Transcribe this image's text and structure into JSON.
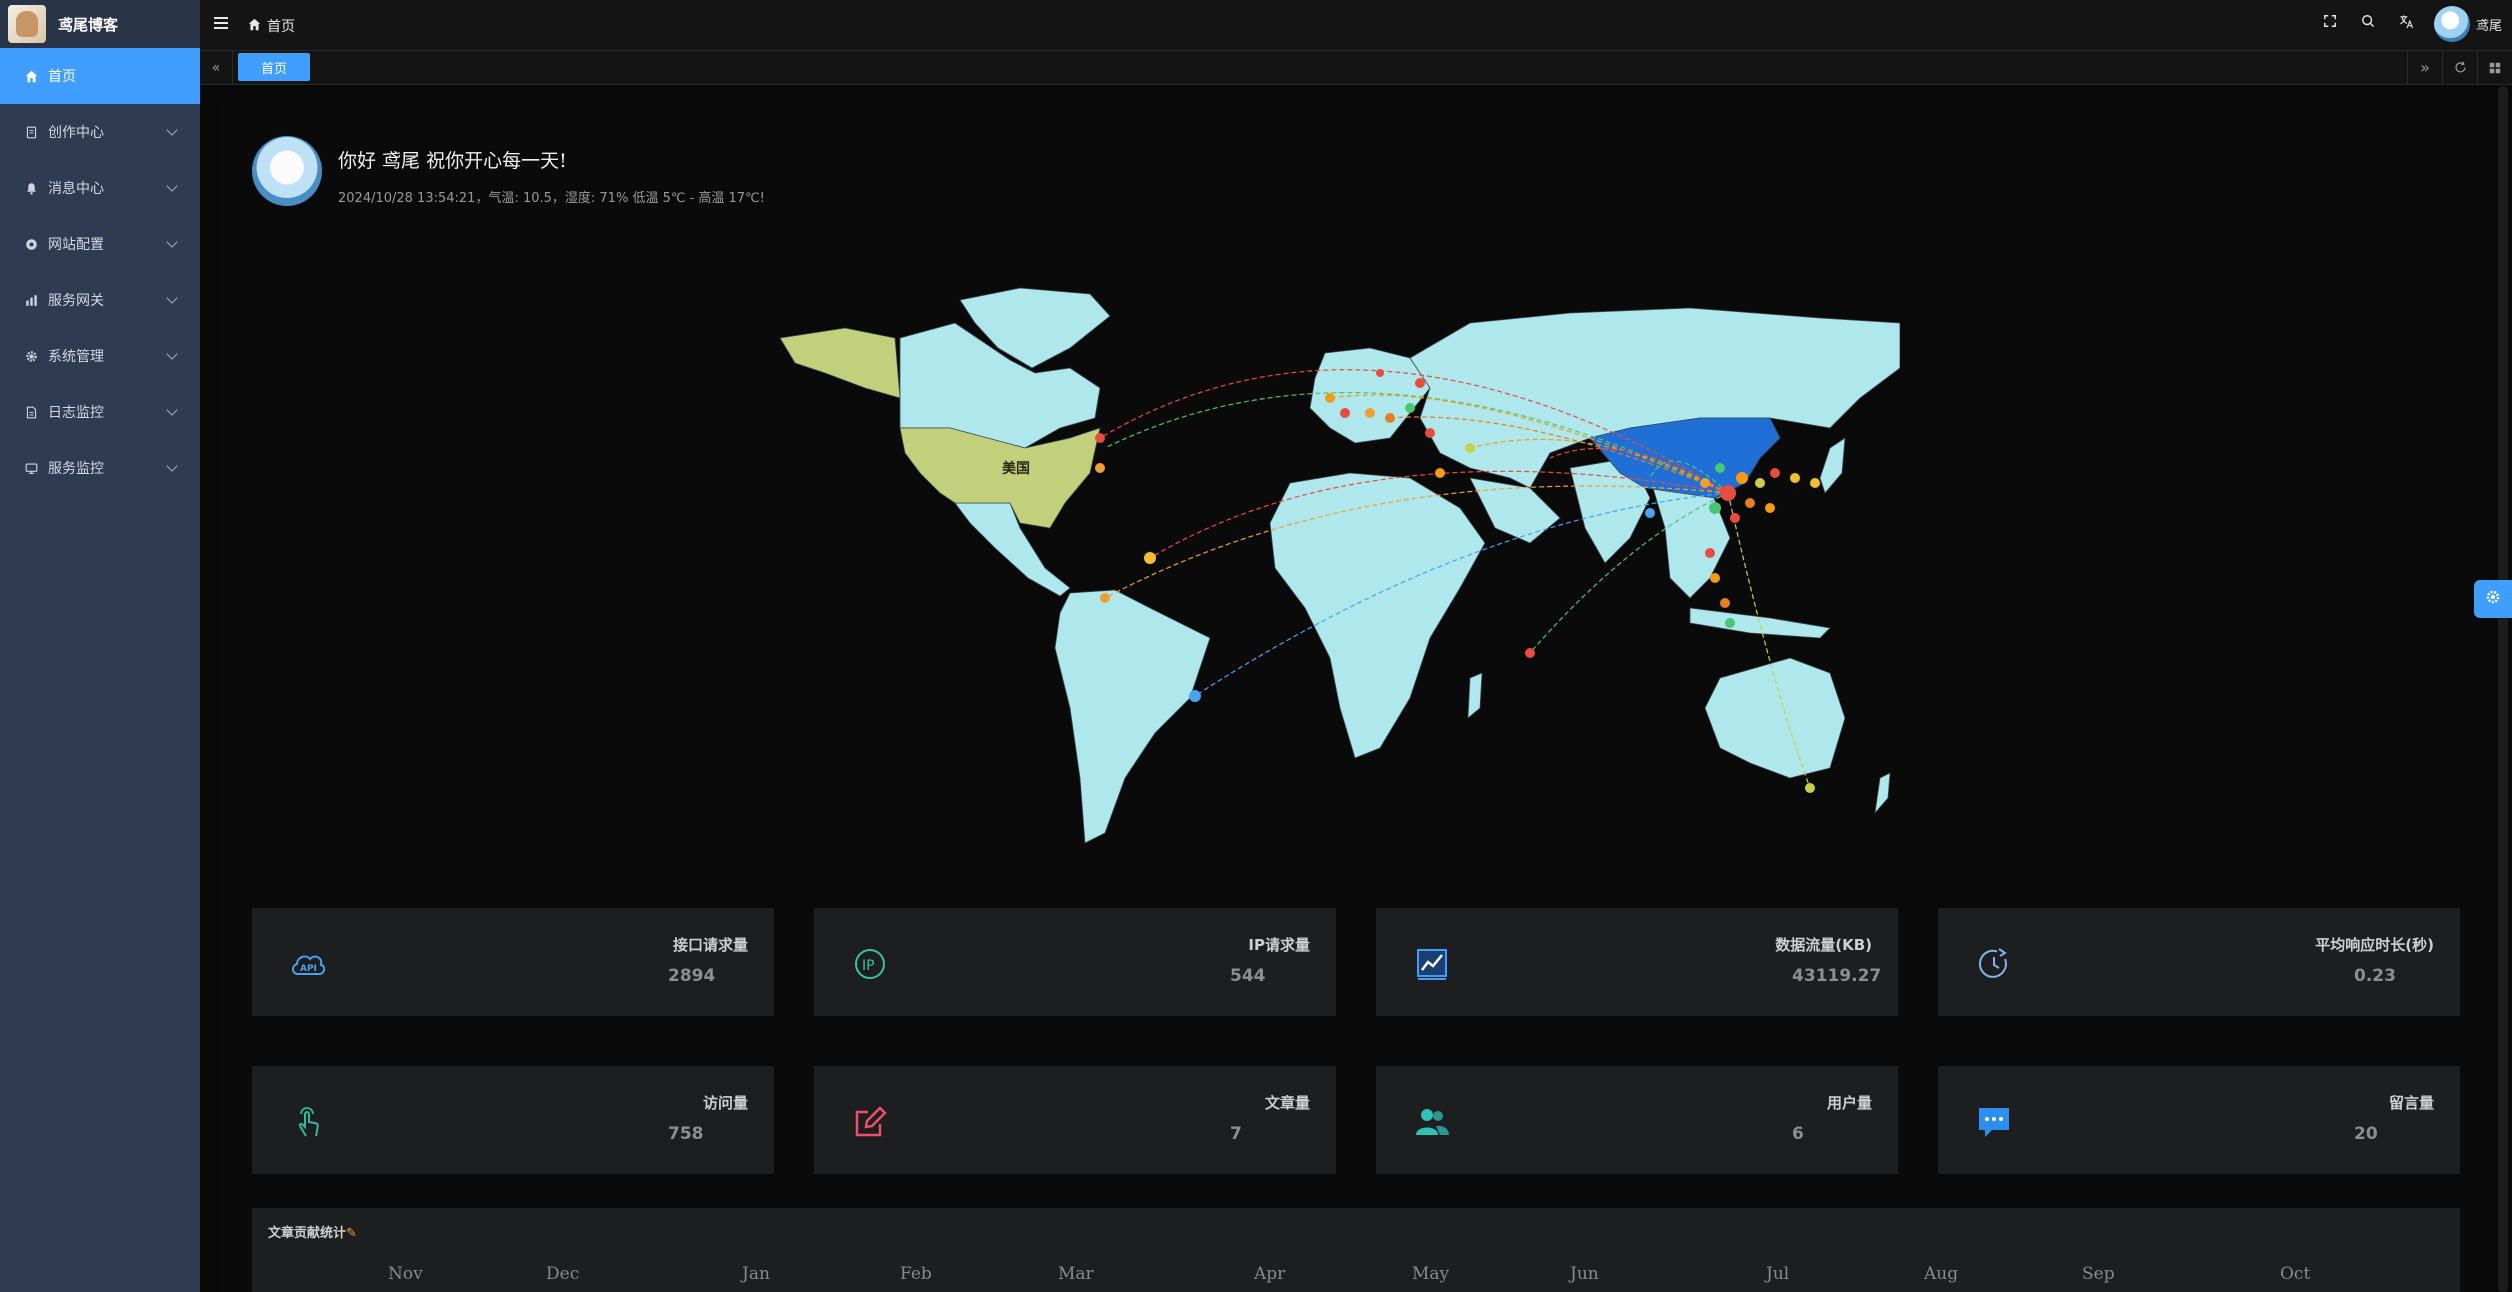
{
  "app": {
    "title": "鸢尾博客"
  },
  "sidebar": {
    "items": [
      {
        "label": "首页",
        "icon": "home-icon",
        "active": true
      },
      {
        "label": "创作中心",
        "icon": "document-icon"
      },
      {
        "label": "消息中心",
        "icon": "bell-icon"
      },
      {
        "label": "网站配置",
        "icon": "settings-icon"
      },
      {
        "label": "服务网关",
        "icon": "chart-icon"
      },
      {
        "label": "系统管理",
        "icon": "gear-icon"
      },
      {
        "label": "日志监控",
        "icon": "log-icon"
      },
      {
        "label": "服务监控",
        "icon": "monitor-icon"
      }
    ]
  },
  "header": {
    "breadcrumb": "首页",
    "username": "鸢尾"
  },
  "tabs": [
    {
      "label": "首页",
      "active": true
    }
  ],
  "greeting": {
    "title": "你好 鸢尾 祝你开心每一天!",
    "subtitle": "2024/10/28 13:54:21，气温: 10.5，湿度: 71% 低温 5℃ - 高温 17℃!"
  },
  "map": {
    "highlight_label": "美国"
  },
  "stats": [
    {
      "label": "接口请求量",
      "value": "2894",
      "icon": "api-cloud-icon",
      "color": "#4aa3f0"
    },
    {
      "label": "IP请求量",
      "value": "544",
      "icon": "ip-icon",
      "color": "#3cc29a"
    },
    {
      "label": "数据流量(KB)",
      "value": "43119.27",
      "icon": "trend-chart-icon",
      "color": "#409eff"
    },
    {
      "label": "平均响应时长(秒)",
      "value": "0.23",
      "icon": "timer-icon",
      "color": "#7fb4f0"
    },
    {
      "label": "访问量",
      "value": "758",
      "icon": "tap-icon",
      "color": "#35b89a"
    },
    {
      "label": "文章量",
      "value": "7",
      "icon": "edit-icon",
      "color": "#f0506e"
    },
    {
      "label": "用户量",
      "value": "6",
      "icon": "users-icon",
      "color": "#2fc2b4"
    },
    {
      "label": "留言量",
      "value": "20",
      "icon": "message-icon",
      "color": "#2c8ff0"
    }
  ],
  "contribution": {
    "title": "文章贡献统计",
    "months": [
      "Nov",
      "Dec",
      "Jan",
      "Feb",
      "Mar",
      "Apr",
      "May",
      "Jun",
      "Jul",
      "Aug",
      "Sep",
      "Oct"
    ]
  }
}
